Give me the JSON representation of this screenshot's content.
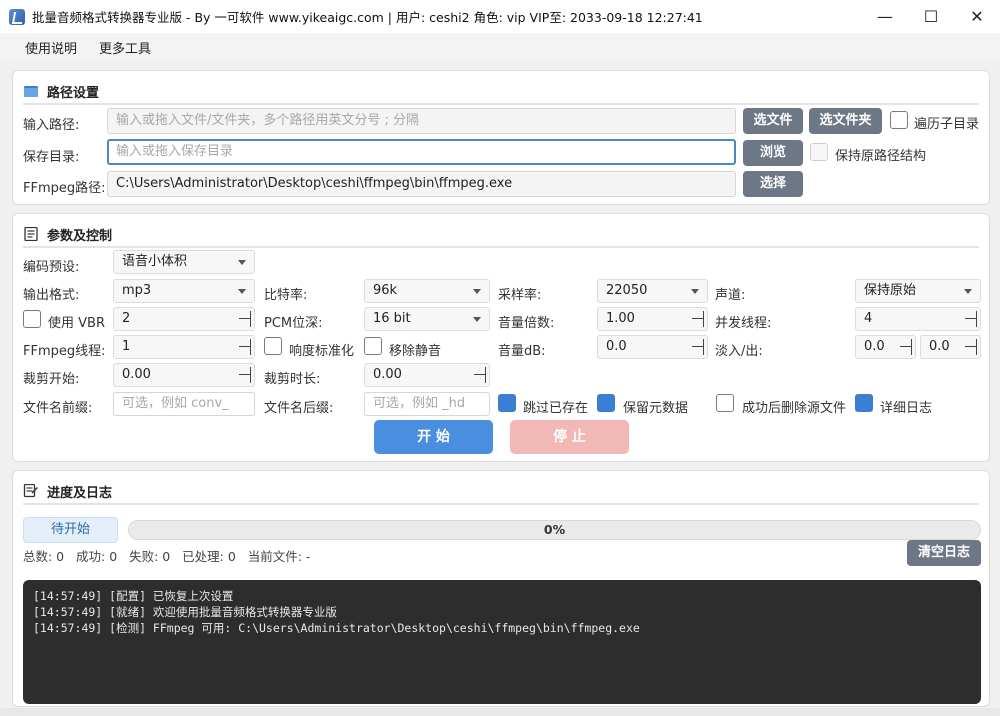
{
  "window": {
    "title": "批量音频格式转换器专业版 - By 一可软件 www.yikeaigc.com   |   用户: ceshi2  角色: vip  VIP至: 2033-09-18 12:27:41",
    "min_glyph": "—",
    "max_glyph": "☐",
    "close_glyph": "✕"
  },
  "menu": {
    "items": [
      "使用说明",
      "更多工具"
    ]
  },
  "path_panel": {
    "title": "路径设置",
    "input_label": "输入路径:",
    "input_placeholder": "输入或拖入文件/文件夹，多个路径用英文分号 ; 分隔",
    "choose_file": "选文件",
    "choose_folder": "选文件夹",
    "recurse_label": "遍历子目录",
    "output_label": "保存目录:",
    "output_placeholder": "输入或拖入保存目录",
    "browse": "浏览",
    "keep_structure_label": "保持原路径结构",
    "ffmpeg_label": "FFmpeg路径:",
    "ffmpeg_value": "C:\\Users\\Administrator\\Desktop\\ceshi\\ffmpeg\\bin\\ffmpeg.exe",
    "select": "选择"
  },
  "params_panel": {
    "title": "参数及控制",
    "preset_label": "编码预设:",
    "preset_value": "语音小体积",
    "format_label": "输出格式:",
    "format_value": "mp3",
    "bitrate_label": "比特率:",
    "bitrate_value": "96k",
    "samplerate_label": "采样率:",
    "samplerate_value": "22050",
    "channel_label": "声道:",
    "channel_value": "保持原始",
    "vbr_label": "使用 VBR",
    "vbr_value": "2",
    "pcm_label": "PCM位深:",
    "pcm_value": "16 bit",
    "volume_mult_label": "音量倍数:",
    "volume_mult_value": "1.00",
    "threads_label": "并发线程:",
    "threads_value": "4",
    "ffmpeg_threads_label": "FFmpeg线程:",
    "ffmpeg_threads_value": "1",
    "loudnorm_label": "响度标准化",
    "silence_label": "移除静音",
    "volume_db_label": "音量dB:",
    "volume_db_value": "0.0",
    "fade_label": "淡入/出:",
    "fade_in_value": "0.0",
    "fade_out_value": "0.0",
    "trim_start_label": "裁剪开始:",
    "trim_start_value": "0.00",
    "trim_len_label": "裁剪时长:",
    "trim_len_value": "0.00",
    "prefix_label": "文件名前缀:",
    "prefix_placeholder": "可选，例如 conv_",
    "suffix_label": "文件名后缀:",
    "suffix_placeholder": "可选，例如 _hd",
    "skip_existing_label": "跳过已存在",
    "keep_meta_label": "保留元数据",
    "delete_src_label": "成功后删除源文件",
    "verbose_label": "详细日志",
    "start": "开 始",
    "stop": "停 止"
  },
  "progress_panel": {
    "title": "进度及日志",
    "status": "待开始",
    "percent_text": "0%",
    "percent": 0,
    "stats": "总数: 0   成功: 0   失败: 0   已处理: 0   当前文件: -",
    "clear_log": "清空日志",
    "log_lines": [
      "[14:57:49] [配置] 已恢复上次设置",
      "[14:57:49] [就绪] 欢迎使用批量音频格式转换器专业版",
      "[14:57:49] [检测] FFmpeg 可用: C:\\Users\\Administrator\\Desktop\\ceshi\\ffmpeg\\bin\\ffmpeg.exe"
    ]
  },
  "colors": {
    "accent": "#3b7fd4",
    "start_button": "#4a8ee0",
    "stop_button": "#f2b8b5",
    "gray_button": "#6e7785",
    "log_bg": "#2d2d2d"
  }
}
